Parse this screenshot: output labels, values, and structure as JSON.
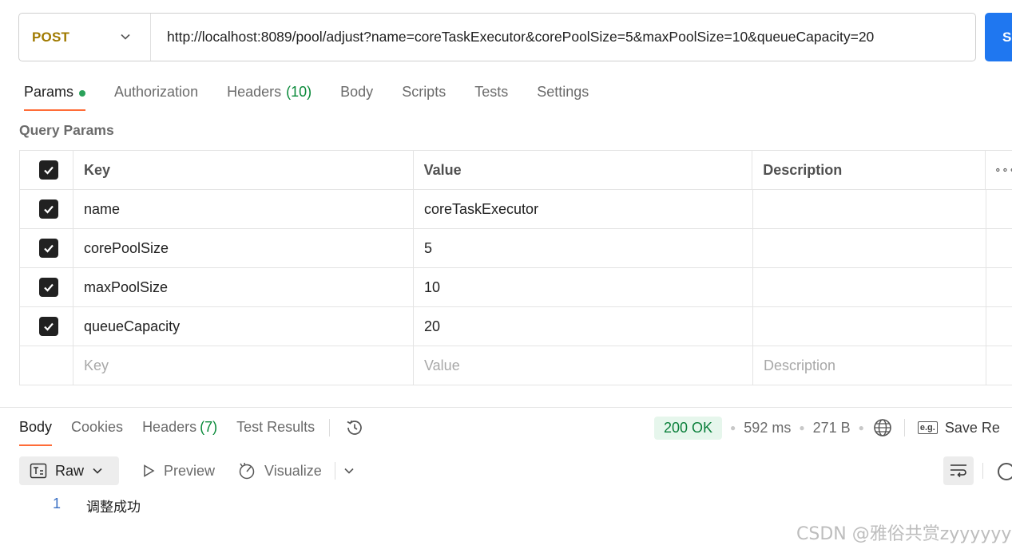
{
  "request": {
    "method": "POST",
    "url": "http://localhost:8089/pool/adjust?name=coreTaskExecutor&corePoolSize=5&maxPoolSize=10&queueCapacity=20",
    "send_label": "S"
  },
  "request_tabs": [
    {
      "label": "Params",
      "count": "",
      "active": true
    },
    {
      "label": "Authorization",
      "count": ""
    },
    {
      "label": "Headers",
      "count": "(10)"
    },
    {
      "label": "Body",
      "count": ""
    },
    {
      "label": "Scripts",
      "count": ""
    },
    {
      "label": "Tests",
      "count": ""
    },
    {
      "label": "Settings",
      "count": ""
    }
  ],
  "query_params": {
    "title": "Query Params",
    "headers": {
      "key": "Key",
      "value": "Value",
      "description": "Description",
      "more": "∘∘∘"
    },
    "rows": [
      {
        "key": "name",
        "value": "coreTaskExecutor",
        "description": ""
      },
      {
        "key": "corePoolSize",
        "value": "5",
        "description": ""
      },
      {
        "key": "maxPoolSize",
        "value": "10",
        "description": ""
      },
      {
        "key": "queueCapacity",
        "value": "20",
        "description": ""
      }
    ],
    "placeholder": {
      "key": "Key",
      "value": "Value",
      "description": "Description"
    }
  },
  "response_tabs": [
    {
      "label": "Body",
      "count": "",
      "active": true
    },
    {
      "label": "Cookies",
      "count": ""
    },
    {
      "label": "Headers",
      "count": "(7)"
    },
    {
      "label": "Test Results",
      "count": ""
    }
  ],
  "response_status": {
    "status": "200 OK",
    "time": "592 ms",
    "size": "271 B",
    "save_icon_label": "e.g.",
    "save_label": "Save Re"
  },
  "response_toolbar": {
    "format": "Raw",
    "preview": "Preview",
    "visualize": "Visualize"
  },
  "response_body": {
    "line_number": "1",
    "line_text": "调整成功"
  },
  "watermark": "CSDN @雅俗共赏zyyyyyy"
}
